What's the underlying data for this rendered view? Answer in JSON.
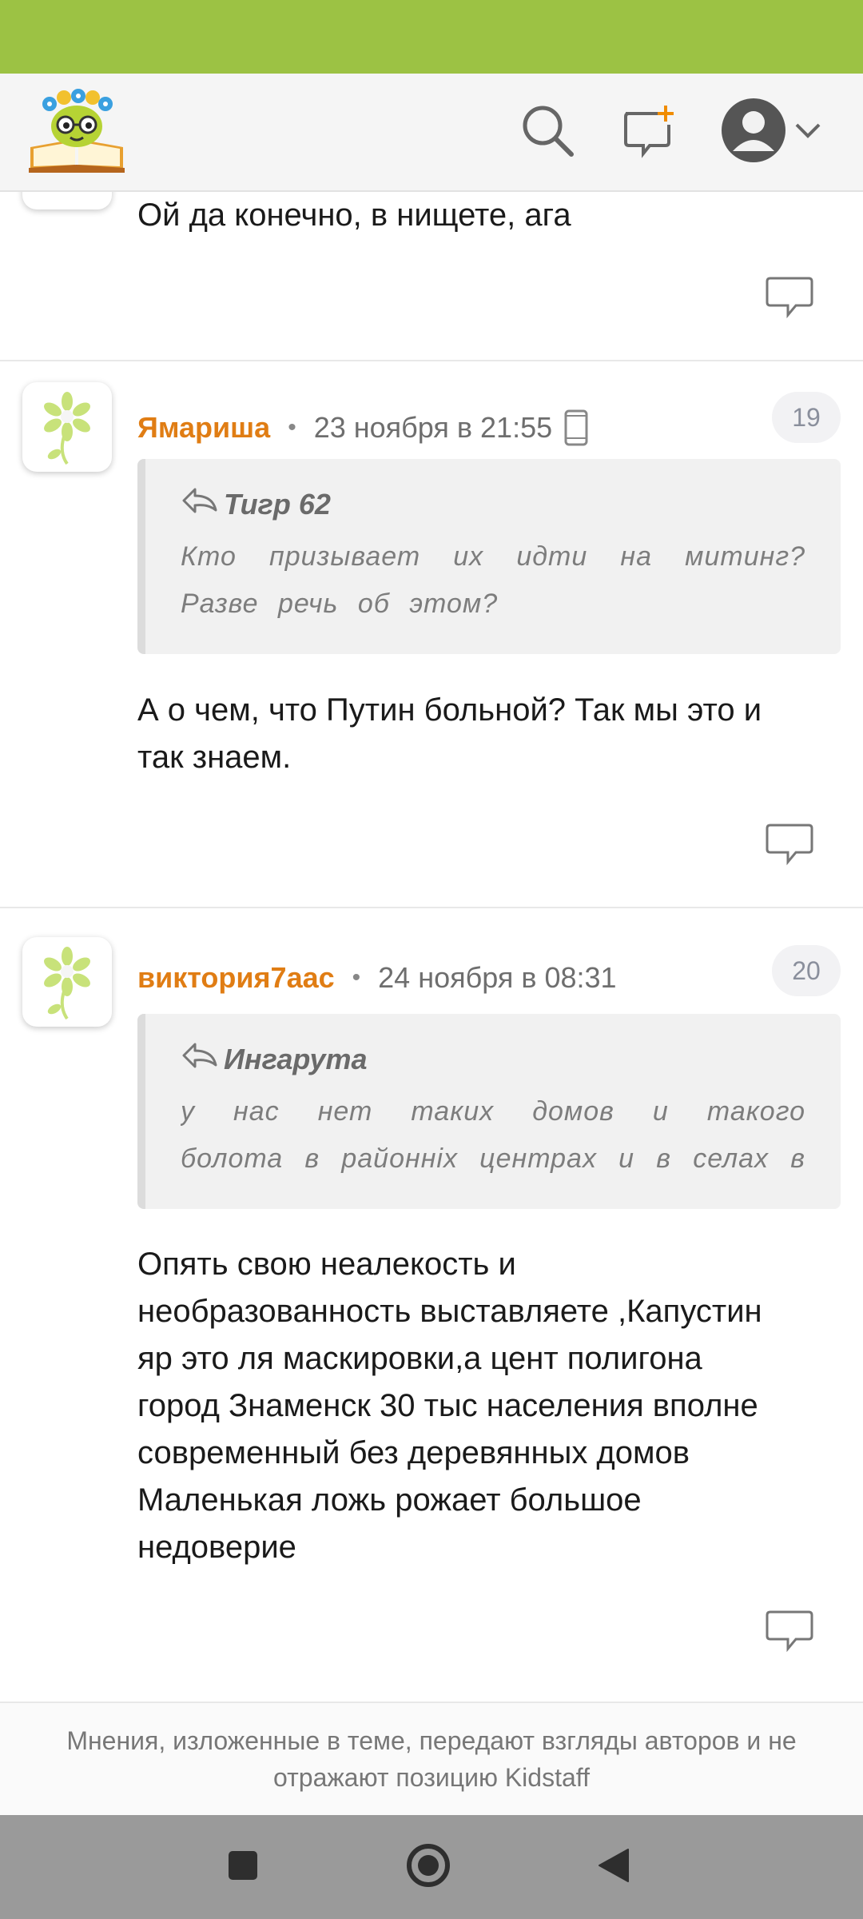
{
  "header": {
    "logo_icon": "kidstaff-logo-icon",
    "search_icon": "search-icon",
    "new_message_icon": "new-message-icon",
    "user_icon": "user-avatar-icon",
    "accent_color": "#9cc244"
  },
  "posts": [
    {
      "body": "Ой да конечно, в нищете, ага"
    },
    {
      "author": "Ямариша",
      "date": "23 ноября в 21:55",
      "device": "mobile-phone-icon",
      "number": "19",
      "quote_author": "Тигр 62",
      "quote_text": "Кто призывает их идти на митинг? Разве речь об этом?",
      "body": "А о чем, что Путин больной? Так мы это и\nтак знаем."
    },
    {
      "author": "виктория7аас",
      "date": "24 ноября в 08:31",
      "number": "20",
      "quote_author": "Ингарута",
      "quote_text": "у нас нет таких домов и такого болота в районніх центрах и в селах в цу раз и мі …",
      "body": "Опять свою неалекость и\nнеобразованность выставляете ,Капустин\nяр это ля маскировки,а цент полигона\nгород Знаменск 30 тыс населения вполне\nсовременный без деревянных домов\nМаленькая ложь рожает большое\nнедоверие"
    }
  ],
  "footer": {
    "disclaimer": "Мнения, изложенные в теме, передают взгляды авторов и не отражают позицию Kidstaff"
  },
  "navbar": {
    "recents_icon": "square-icon",
    "home_icon": "circle-icon",
    "back_icon": "triangle-back-icon"
  }
}
